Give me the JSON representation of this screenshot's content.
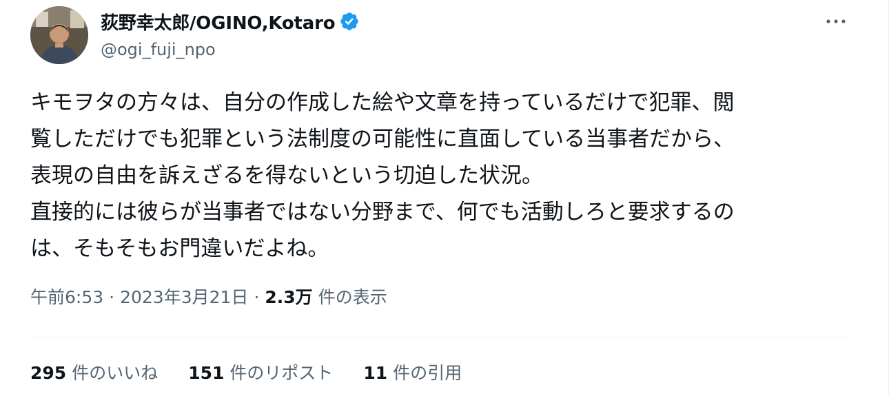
{
  "author": {
    "display_name": "荻野幸太郎/OGINO,Kotaro",
    "handle": "@ogi_fuji_npo",
    "avatar_icon": "user-photo-avatar",
    "verified_icon": "verified-badge-icon",
    "verified_color": "#1d9bf0"
  },
  "menu": {
    "more_icon": "more-options-icon"
  },
  "tweet": {
    "lines": [
      "キモヲタの方々は、自分の作成した絵や文章を持っているだけで犯罪、閲",
      "覧しただけでも犯罪という法制度の可能性に直面している当事者だから、",
      "表現の自由を訴えざるを得ないという切迫した状況。",
      "直接的には彼らが当事者ではない分野まで、何でも活動しろと要求するの",
      "は、そもそもお門違いだよね。"
    ]
  },
  "meta": {
    "time": "午前6:53",
    "separator": "·",
    "date": "2023年3月21日",
    "views_count": "2.3万",
    "views_label": "件の表示"
  },
  "stats": {
    "likes_count": "295",
    "likes_label": "件のいいね",
    "reposts_count": "151",
    "reposts_label": "件のリポスト",
    "quotes_count": "11",
    "quotes_label": "件の引用"
  },
  "colors": {
    "text_primary": "#0f1419",
    "text_secondary": "#536471",
    "divider": "#eff3f4"
  }
}
